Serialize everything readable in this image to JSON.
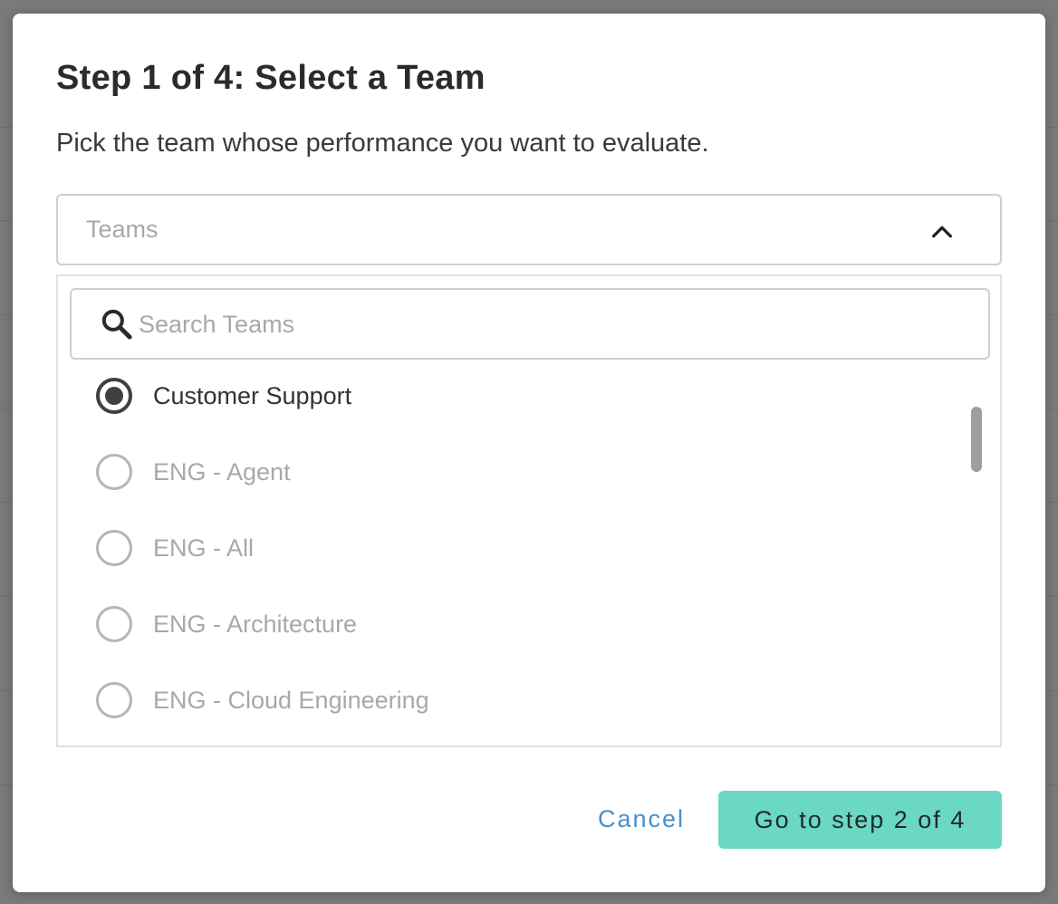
{
  "modal": {
    "title": "Step 1 of 4: Select a Team",
    "subtitle": "Pick the team whose performance you want to evaluate."
  },
  "teams_select": {
    "placeholder": "Teams",
    "expanded": true,
    "chevron_icon": "chevron-up-icon"
  },
  "search": {
    "placeholder": "Search Teams",
    "value": "",
    "icon": "search-icon"
  },
  "team_options": [
    {
      "label": "Customer Support",
      "selected": true
    },
    {
      "label": "ENG - Agent",
      "selected": false
    },
    {
      "label": "ENG - All",
      "selected": false
    },
    {
      "label": "ENG - Architecture",
      "selected": false
    },
    {
      "label": "ENG - Cloud Engineering",
      "selected": false
    }
  ],
  "actions": {
    "cancel_label": "Cancel",
    "next_label": "Go to step 2 of 4"
  },
  "colors": {
    "accent": "#6ad8c4",
    "link": "#4a8fc8",
    "backdrop": "#7a7a7a"
  }
}
